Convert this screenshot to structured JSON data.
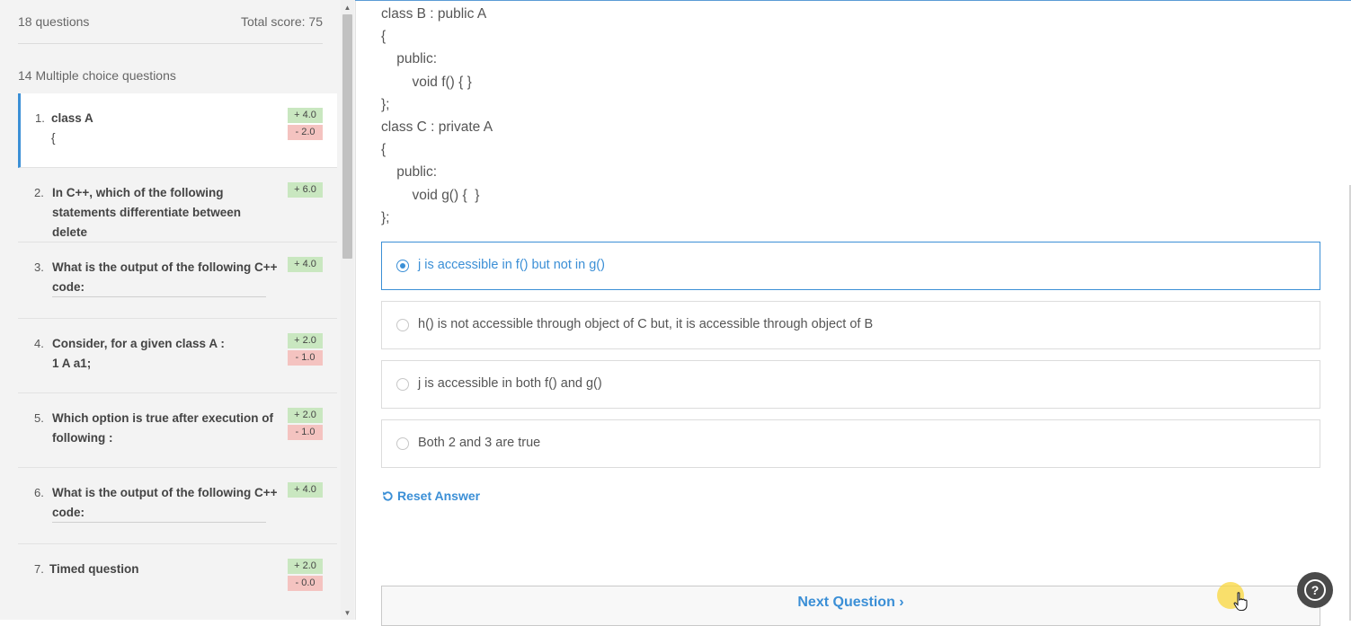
{
  "sidebar": {
    "question_count": "18 questions",
    "total_score": "Total score: 75",
    "section_title": "14 Multiple choice questions",
    "questions": [
      {
        "num": "1.",
        "text": "class A",
        "sub": "{",
        "pos": "+ 4.0",
        "neg": "- 2.0"
      },
      {
        "num": "2.",
        "text": "In C++, which of the following statements differentiate between delete",
        "pos": "+ 6.0"
      },
      {
        "num": "3.",
        "text": "What is the output of the following C++ code:",
        "pos": "+ 4.0"
      },
      {
        "num": "4.",
        "text": "Consider, for a given class A :",
        "sub": "1 A a1;",
        "pos": "+ 2.0",
        "neg": "- 1.0"
      },
      {
        "num": "5.",
        "text": "Which option is true after execution of following :",
        "pos": "+ 2.0",
        "neg": "- 1.0"
      },
      {
        "num": "6.",
        "text": "What is the output of the following C++ code:",
        "pos": "+ 4.0"
      },
      {
        "num": "7.",
        "text": "Timed question",
        "pos": "+ 2.0",
        "neg": "- 0.0"
      }
    ]
  },
  "code_lines": [
    "class B : public A",
    "{",
    "    public:",
    "        void f() { }",
    "};",
    "class C : private A",
    "{",
    "    public:",
    "        void g() {  }",
    "};"
  ],
  "options": [
    {
      "label": "j is accessible in f() but not in g()",
      "selected": true
    },
    {
      "label": "h() is not accessible through object of C but, it is accessible through object of B"
    },
    {
      "label": "j is accessible in both f() and g()"
    },
    {
      "label": "Both 2 and 3 are true"
    }
  ],
  "reset_label": "Reset Answer",
  "next_label": "Next Question ›",
  "help_label": "?",
  "colors": {
    "accent": "#3b8fd6",
    "positive": "#c9e7c0",
    "negative": "#f4c3c0"
  }
}
